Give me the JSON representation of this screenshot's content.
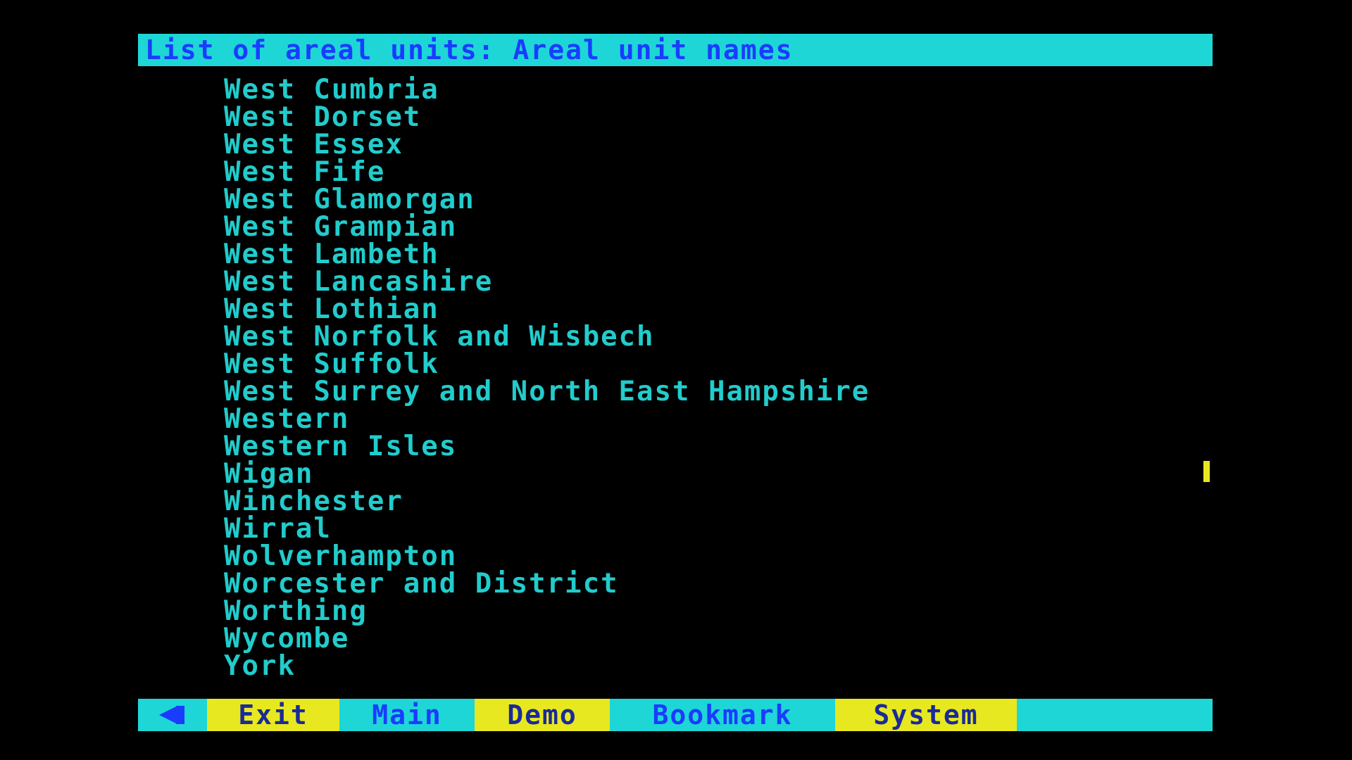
{
  "header": {
    "title": "List of areal units: Areal unit names"
  },
  "units": [
    "West Cumbria",
    "West Dorset",
    "West Essex",
    "West Fife",
    "West Glamorgan",
    "West Grampian",
    "West Lambeth",
    "West Lancashire",
    "West Lothian",
    "West Norfolk and Wisbech",
    "West Suffolk",
    "West Surrey and North East Hampshire",
    "Western",
    "Western Isles",
    "Wigan",
    "Winchester",
    "Wirral",
    "Wolverhampton",
    "Worcester and District",
    "Worthing",
    "Wycombe",
    "York"
  ],
  "menu": {
    "back_icon": "back-arrow-icon",
    "exit_label": "Exit",
    "main_label": "Main",
    "demo_label": "Demo",
    "bookmark_label": "Bookmark",
    "system_label": "System"
  },
  "colors": {
    "background": "#000000",
    "bar": "#1ed6d6",
    "list_text": "#22cccc",
    "title_text": "#1a3cff",
    "highlight": "#e8e820"
  }
}
